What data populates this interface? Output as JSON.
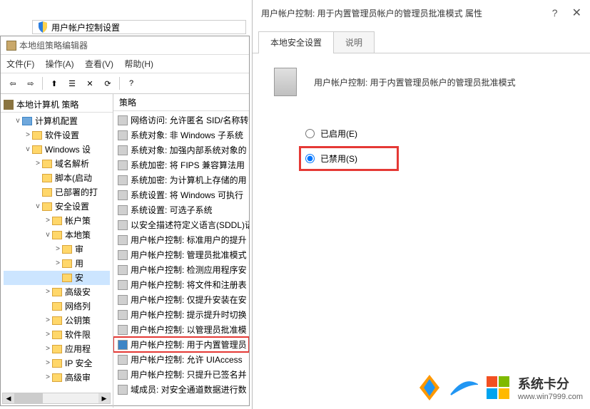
{
  "uac_bg": {
    "title": "用户帐户控制设置"
  },
  "gpedit": {
    "title": "本地组策略编辑器",
    "menu": {
      "file": "文件(F)",
      "action": "操作(A)",
      "view": "查看(V)",
      "help": "帮助(H)"
    },
    "tree_header": "本地计算机 策略",
    "tree": [
      {
        "label": "计算机配置",
        "indent": 1,
        "expand": "v",
        "icon": "computer"
      },
      {
        "label": "软件设置",
        "indent": 2,
        "expand": ">",
        "icon": "folder"
      },
      {
        "label": "Windows 设",
        "indent": 2,
        "expand": "v",
        "icon": "folder"
      },
      {
        "label": "域名解析",
        "indent": 3,
        "expand": ">",
        "icon": "folder"
      },
      {
        "label": "脚本(启动",
        "indent": 3,
        "expand": "",
        "icon": "folder"
      },
      {
        "label": "已部署的打",
        "indent": 3,
        "expand": "",
        "icon": "folder"
      },
      {
        "label": "安全设置",
        "indent": 3,
        "expand": "v",
        "icon": "lock"
      },
      {
        "label": "帐户策",
        "indent": 4,
        "expand": ">",
        "icon": "lock"
      },
      {
        "label": "本地策",
        "indent": 4,
        "expand": "v",
        "icon": "lock"
      },
      {
        "label": "审",
        "indent": 5,
        "expand": ">",
        "icon": "lock"
      },
      {
        "label": "用",
        "indent": 5,
        "expand": ">",
        "icon": "lock"
      },
      {
        "label": "安",
        "indent": 5,
        "expand": "",
        "icon": "lock",
        "selected": true
      },
      {
        "label": "高级安",
        "indent": 4,
        "expand": ">",
        "icon": "folder"
      },
      {
        "label": "网络列",
        "indent": 4,
        "expand": "",
        "icon": "folder"
      },
      {
        "label": "公钥策",
        "indent": 4,
        "expand": ">",
        "icon": "folder"
      },
      {
        "label": "软件限",
        "indent": 4,
        "expand": ">",
        "icon": "folder"
      },
      {
        "label": "应用程",
        "indent": 4,
        "expand": ">",
        "icon": "folder"
      },
      {
        "label": "IP 安全",
        "indent": 4,
        "expand": ">",
        "icon": "folder"
      },
      {
        "label": "高级审",
        "indent": 4,
        "expand": ">",
        "icon": "folder"
      }
    ],
    "list_header": "策略",
    "policies": [
      "网络访问: 允许匿名 SID/名称转",
      "系统对象: 非 Windows 子系统",
      "系统对象: 加强内部系统对象的",
      "系统加密: 将 FIPS 兼容算法用",
      "系统加密: 为计算机上存储的用",
      "系统设置: 将 Windows 可执行",
      "系统设置: 可选子系统",
      "以安全描述符定义语言(SDDL)语",
      "用户帐户控制: 标准用户的提升",
      "用户帐户控制: 管理员批准模式",
      "用户帐户控制: 检测应用程序安",
      "用户帐户控制: 将文件和注册表",
      "用户帐户控制: 仅提升安装在安",
      "用户帐户控制: 提示提升时切换",
      "用户帐户控制: 以管理员批准模",
      "用户帐户控制: 用于内置管理员",
      "用户帐户控制: 允许 UIAccess",
      "用户帐户控制: 只提升已签名并",
      "域成员: 对安全通道数据进行数"
    ],
    "selected_policy_index": 15
  },
  "dialog": {
    "title": "用户帐户控制: 用于内置管理员帐户的管理员批准模式 属性",
    "tabs": {
      "security": "本地安全设置",
      "explain": "说明"
    },
    "policy_name": "用户帐户控制: 用于内置管理员帐户的管理员批准模式",
    "enabled": "已启用(E)",
    "disabled": "已禁用(S)"
  },
  "watermark": {
    "text": "系统卡分",
    "url": "www.win7999.com"
  }
}
